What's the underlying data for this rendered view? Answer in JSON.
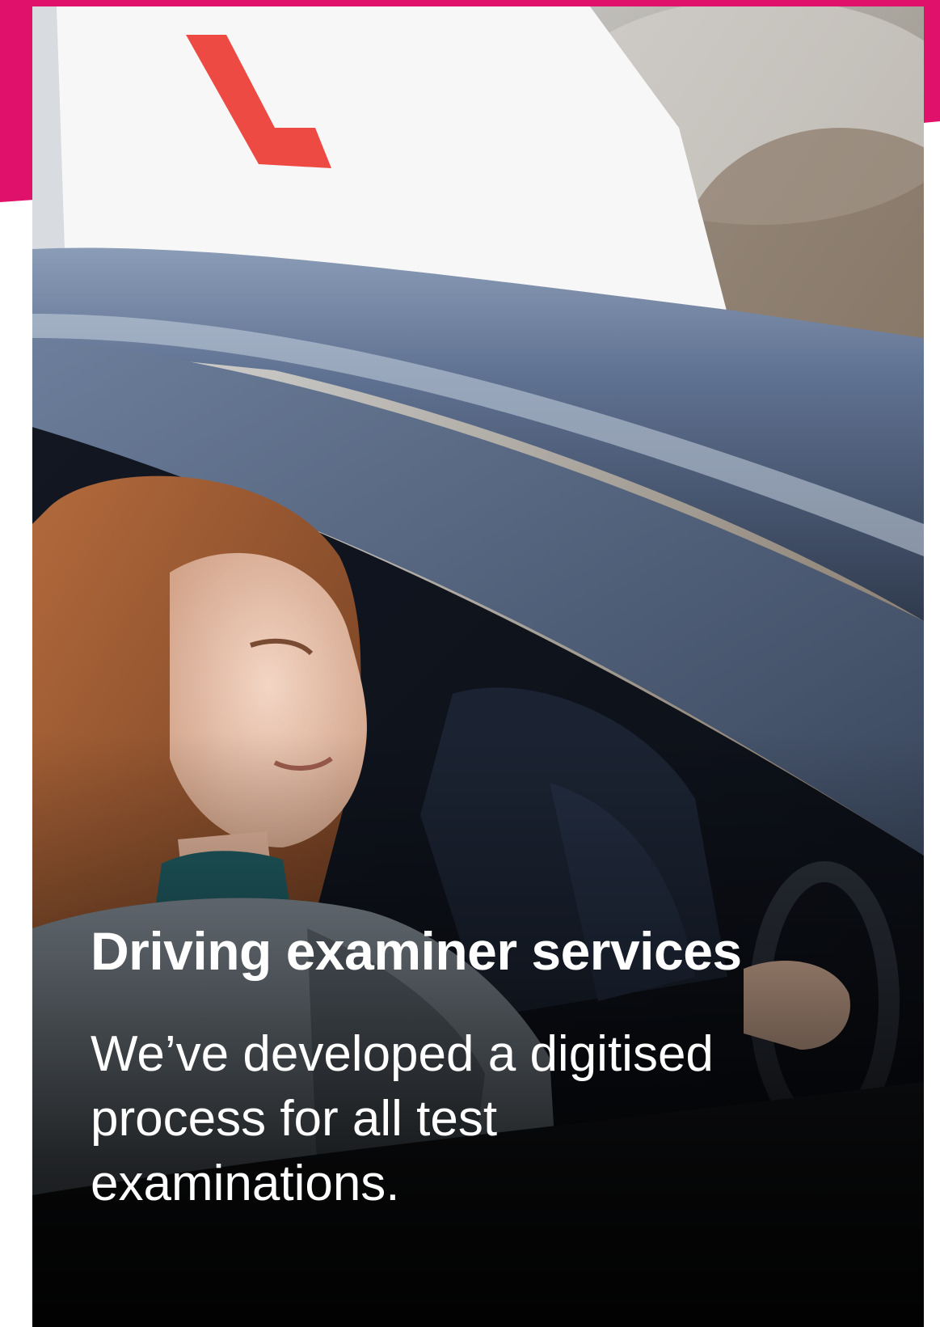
{
  "brand": {
    "accent_color": "#e0116b"
  },
  "card": {
    "image_subject": "learner-driver-photo",
    "title": "Driving examiner services",
    "description": "We’ve developed a digitised process for all test examinations."
  }
}
